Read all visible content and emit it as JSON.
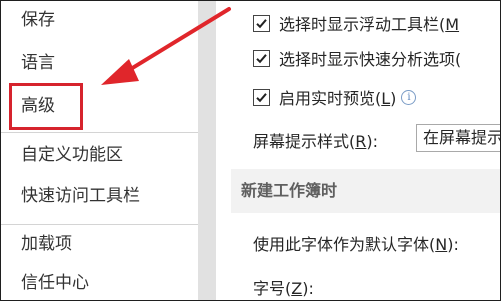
{
  "sidebar": {
    "items": [
      {
        "label": "保存"
      },
      {
        "label": "语言"
      },
      {
        "label": "高级"
      },
      {
        "label": "自定义功能区"
      },
      {
        "label": "快速访问工具栏"
      },
      {
        "label": "加载项"
      },
      {
        "label": "信任中心"
      }
    ],
    "selected": "高级"
  },
  "content": {
    "options": [
      {
        "text_before": "选择时显示浮动工具栏(",
        "key": "M",
        "text_after": "",
        "checked": true
      },
      {
        "text_before": "选择时显示快速分析选项(",
        "key": "",
        "text_after": "",
        "checked": true
      },
      {
        "text_before": "启用实时预览(",
        "key": "L",
        "text_after": ")",
        "checked": true
      }
    ],
    "screentip": {
      "label_before": "屏幕提示样式(",
      "key": "R",
      "label_after": "):",
      "value": "在屏幕提示"
    },
    "section_title": "新建工作簿时",
    "font_row": {
      "label_before": "使用此字体作为默认字体(",
      "key": "N",
      "label_after": "):"
    },
    "size_row": {
      "label_before": "字号(",
      "key": "Z",
      "label_after": "):"
    }
  },
  "colors": {
    "highlight": "#d6232d",
    "arrow": "#e0262b"
  },
  "icons": {
    "check": "checkmark-icon",
    "info": "info-icon",
    "arrow": "red-arrow-annotation"
  }
}
